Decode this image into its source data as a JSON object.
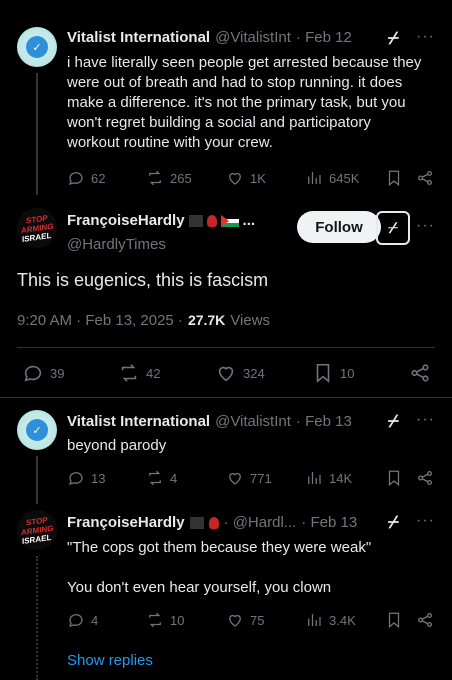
{
  "post1": {
    "name": "Vitalist International",
    "handle": "@VitalistInt",
    "date": "· Feb 12",
    "text": "i have literally seen people get arrested because they were out of breath and had to stop running. it does make a difference. it's not the primary task, but you won't regret building a social and participatory workout routine with your crew.",
    "replies": "62",
    "reposts": "265",
    "likes": "1K",
    "views": "645K"
  },
  "main_post": {
    "name": "FrançoiseHardly",
    "name_suffix": "...",
    "handle": "@HardlyTimes",
    "follow_label": "Follow",
    "text": "This is eugenics, this is fascism",
    "time": "9:20 AM · Feb 13, 2025 ·",
    "views_count": "27.7K",
    "views_label": "Views",
    "replies": "39",
    "reposts": "42",
    "likes": "324",
    "bookmarks": "10"
  },
  "reply1": {
    "name": "Vitalist International",
    "handle": "@VitalistInt",
    "date": "· Feb 13",
    "text": "beyond parody",
    "replies": "13",
    "reposts": "4",
    "likes": "771",
    "views": "14K"
  },
  "reply2": {
    "name": "FrançoiseHardly",
    "handle": "· @Hardl...",
    "date": "· Feb 13",
    "text1": "\"The cops got them because they were weak\"",
    "text2": "You don't even hear yourself, you clown",
    "replies": "4",
    "reposts": "10",
    "likes": "75",
    "views": "3.4K"
  },
  "show_replies": "Show replies",
  "avatar_text": {
    "stop": "STOP",
    "arming": "ARMING",
    "israel": "ISRAEL"
  },
  "colors": {
    "link": "#1d9bf0",
    "muted": "#71767b",
    "background": "#000000"
  }
}
